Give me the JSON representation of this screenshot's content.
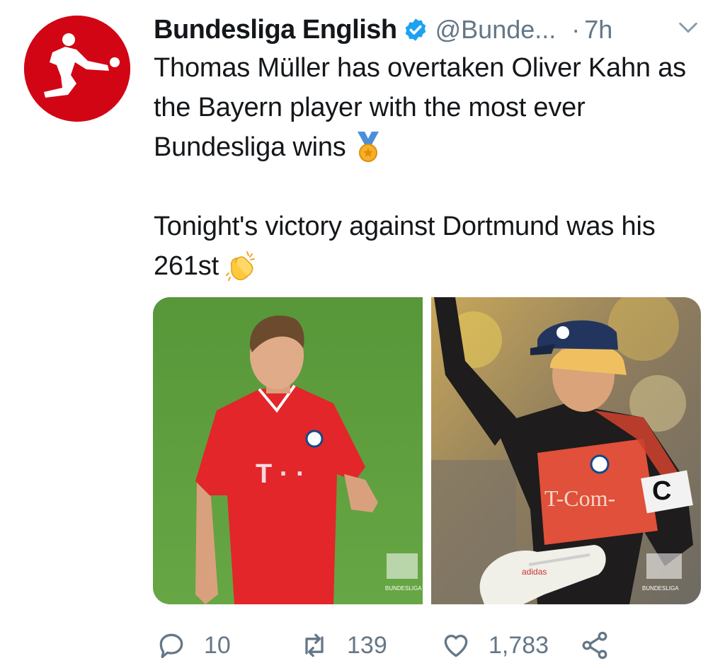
{
  "account": {
    "name": "Bundesliga English",
    "handle": "@Bunde...",
    "separator": "·",
    "time": "7h",
    "verified_icon": "verified-badge-icon",
    "brand_color": "#d20515",
    "verified_color": "#1da1f2"
  },
  "tweet": {
    "paragraph1": "Thomas Müller has overtaken Oliver Kahn as the Bayern player with the most ever Bundesliga wins",
    "paragraph1_emoji": "medal-emoji",
    "paragraph2": "Tonight's victory against Dortmund was his 261st",
    "paragraph2_emoji": "clapping-hands-emoji"
  },
  "media": {
    "left": {
      "shirt_sponsor": "T · ·",
      "watermark": "BUNDESLIGA"
    },
    "right": {
      "shirt_sponsor": "T-Com-",
      "armband": "C",
      "glove_brand": "adidas",
      "watermark": "BUNDESLIGA"
    }
  },
  "actions": {
    "replies": "10",
    "retweets": "139",
    "likes": "1,783"
  },
  "colors": {
    "text": "#14171a",
    "muted": "#657786"
  }
}
